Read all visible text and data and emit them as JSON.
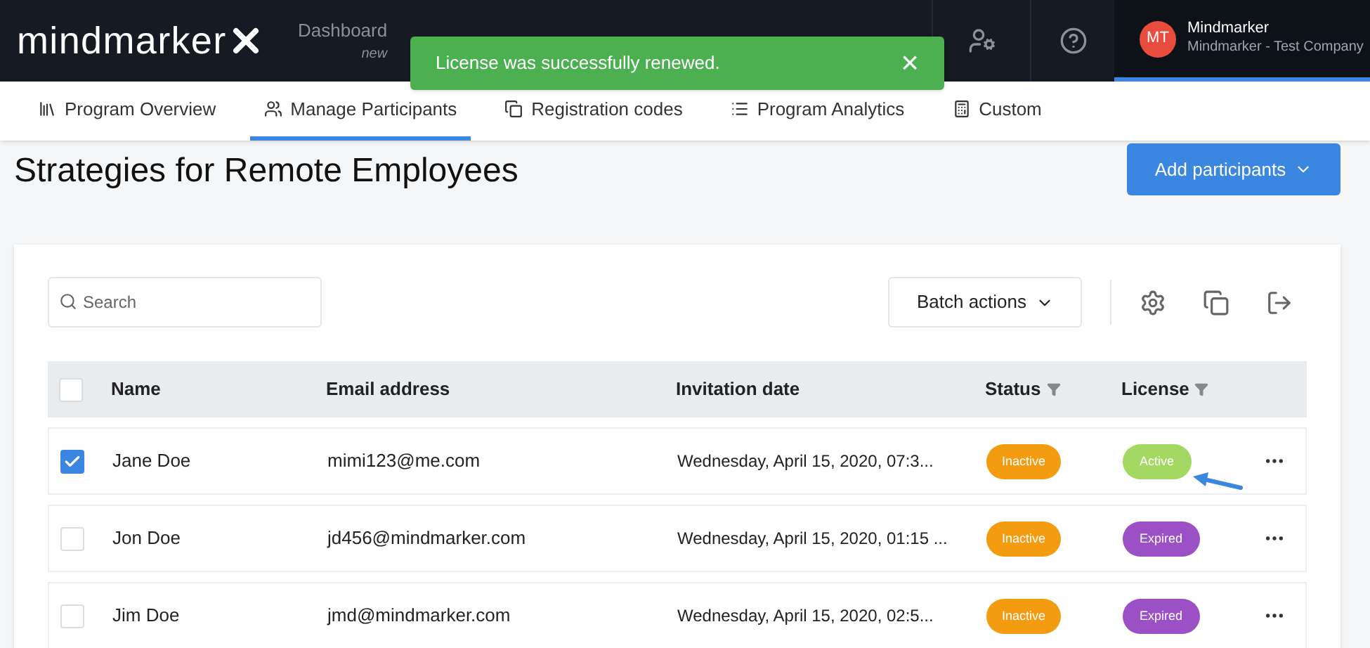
{
  "logo": {
    "text": "mindmarker"
  },
  "nav": [
    {
      "label": "Dashboard",
      "sub": "new"
    }
  ],
  "toast": {
    "message": "License was successfully renewed.",
    "close": "×"
  },
  "profile": {
    "initials": "MT",
    "name": "Mindmarker",
    "company": "Mindmarker - Test Company"
  },
  "tabs": [
    {
      "label": "Program Overview",
      "selected": false
    },
    {
      "label": "Manage Participants",
      "selected": true
    },
    {
      "label": "Registration codes",
      "selected": false
    },
    {
      "label": "Program Analytics",
      "selected": false
    },
    {
      "label": "Custom",
      "selected": false
    }
  ],
  "page": {
    "title": "Strategies for Remote Employees",
    "add_button": "Add participants"
  },
  "search": {
    "placeholder": "Search"
  },
  "batch_button": "Batch actions",
  "table": {
    "all_checked": false,
    "columns": [
      {
        "label": "Name",
        "filter": false
      },
      {
        "label": "Email address",
        "filter": false
      },
      {
        "label": "Invitation date",
        "filter": false
      },
      {
        "label": "Status",
        "filter": true
      },
      {
        "label": "License",
        "filter": true
      }
    ],
    "rows": [
      {
        "checked": true,
        "name": "Jane Doe",
        "email": "mimi123@me.com",
        "date": "Wednesday, April 15, 2020, 07:3...",
        "status": {
          "label": "Inactive",
          "color": "#f39c12"
        },
        "license": {
          "label": "Active",
          "color": "#a3d862"
        },
        "pointer": true
      },
      {
        "checked": false,
        "name": "Jon Doe",
        "email": "jd456@mindmarker.com",
        "date": "Wednesday, April 15, 2020, 01:15 ...",
        "status": {
          "label": "Inactive",
          "color": "#f39c12"
        },
        "license": {
          "label": "Expired",
          "color": "#9b51c5"
        },
        "pointer": false
      },
      {
        "checked": false,
        "name": "Jim Doe",
        "email": "jmd@mindmarker.com",
        "date": "Wednesday, April 15, 2020, 02:5...",
        "status": {
          "label": "Inactive",
          "color": "#f39c12"
        },
        "license": {
          "label": "Expired",
          "color": "#9b51c5"
        },
        "pointer": false
      }
    ]
  }
}
